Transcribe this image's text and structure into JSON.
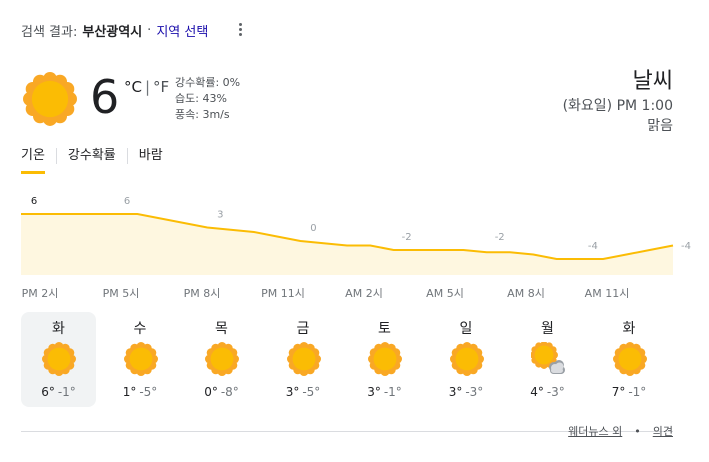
{
  "header": {
    "prefix": "검색 결과:",
    "location": "부산광역시",
    "separator": "·",
    "region_select": "지역 선택"
  },
  "current": {
    "temperature": "6",
    "unit_c": "°C",
    "unit_sep": "|",
    "unit_f": "°F",
    "precipitation": "강수확률: 0%",
    "humidity": "습도: 43%",
    "wind": "풍속: 3m/s",
    "icon": "sun-icon"
  },
  "right": {
    "title": "날씨",
    "time": "(화요일) PM 1:00",
    "condition": "맑음"
  },
  "tabs": [
    {
      "label": "기온",
      "active": true
    },
    {
      "label": "강수확률",
      "active": false
    },
    {
      "label": "바람",
      "active": false
    }
  ],
  "chart_data": {
    "type": "area",
    "x": [
      "PM 2시",
      "PM 5시",
      "PM 8시",
      "PM 11시",
      "AM 2시",
      "AM 5시",
      "AM 8시",
      "AM 11시"
    ],
    "series": [
      {
        "values": [
          6,
          6,
          3,
          0,
          -2,
          -2,
          -4,
          -4
        ],
        "hourly_values": [
          6,
          6,
          6,
          6,
          6,
          6,
          5,
          4,
          3,
          2.5,
          2,
          1,
          0,
          -0.5,
          -1,
          -1,
          -2,
          -2,
          -2,
          -2,
          -2.5,
          -2.5,
          -3,
          -4,
          -4,
          -4,
          -3,
          -2,
          -1
        ]
      }
    ],
    "point_labels": [
      "6",
      "6",
      "3",
      "0",
      "-2",
      "-2",
      "-4",
      "-4"
    ],
    "line_color": "#fbbc04",
    "fill_color": "#fef7e0"
  },
  "forecast": [
    {
      "day": "화",
      "high": "6°",
      "low": "-1°",
      "icon": "sun-icon",
      "selected": true
    },
    {
      "day": "수",
      "high": "1°",
      "low": "-5°",
      "icon": "sun-icon",
      "selected": false
    },
    {
      "day": "목",
      "high": "0°",
      "low": "-8°",
      "icon": "sun-icon",
      "selected": false
    },
    {
      "day": "금",
      "high": "3°",
      "low": "-5°",
      "icon": "sun-icon",
      "selected": false
    },
    {
      "day": "토",
      "high": "3°",
      "low": "-1°",
      "icon": "sun-icon",
      "selected": false
    },
    {
      "day": "일",
      "high": "3°",
      "low": "-3°",
      "icon": "sun-icon",
      "selected": false
    },
    {
      "day": "월",
      "high": "4°",
      "low": "-3°",
      "icon": "partly-cloudy-icon",
      "selected": false
    },
    {
      "day": "화",
      "high": "7°",
      "low": "-1°",
      "icon": "sun-icon",
      "selected": false
    }
  ],
  "footer": {
    "source": "웨더뉴스 외",
    "dot": "•",
    "feedback": "의견"
  },
  "colors": {
    "sun_outer": "#f9a825",
    "sun_inner": "#fbbc04",
    "accent": "#fbbc04",
    "link": "#1a0dab"
  }
}
